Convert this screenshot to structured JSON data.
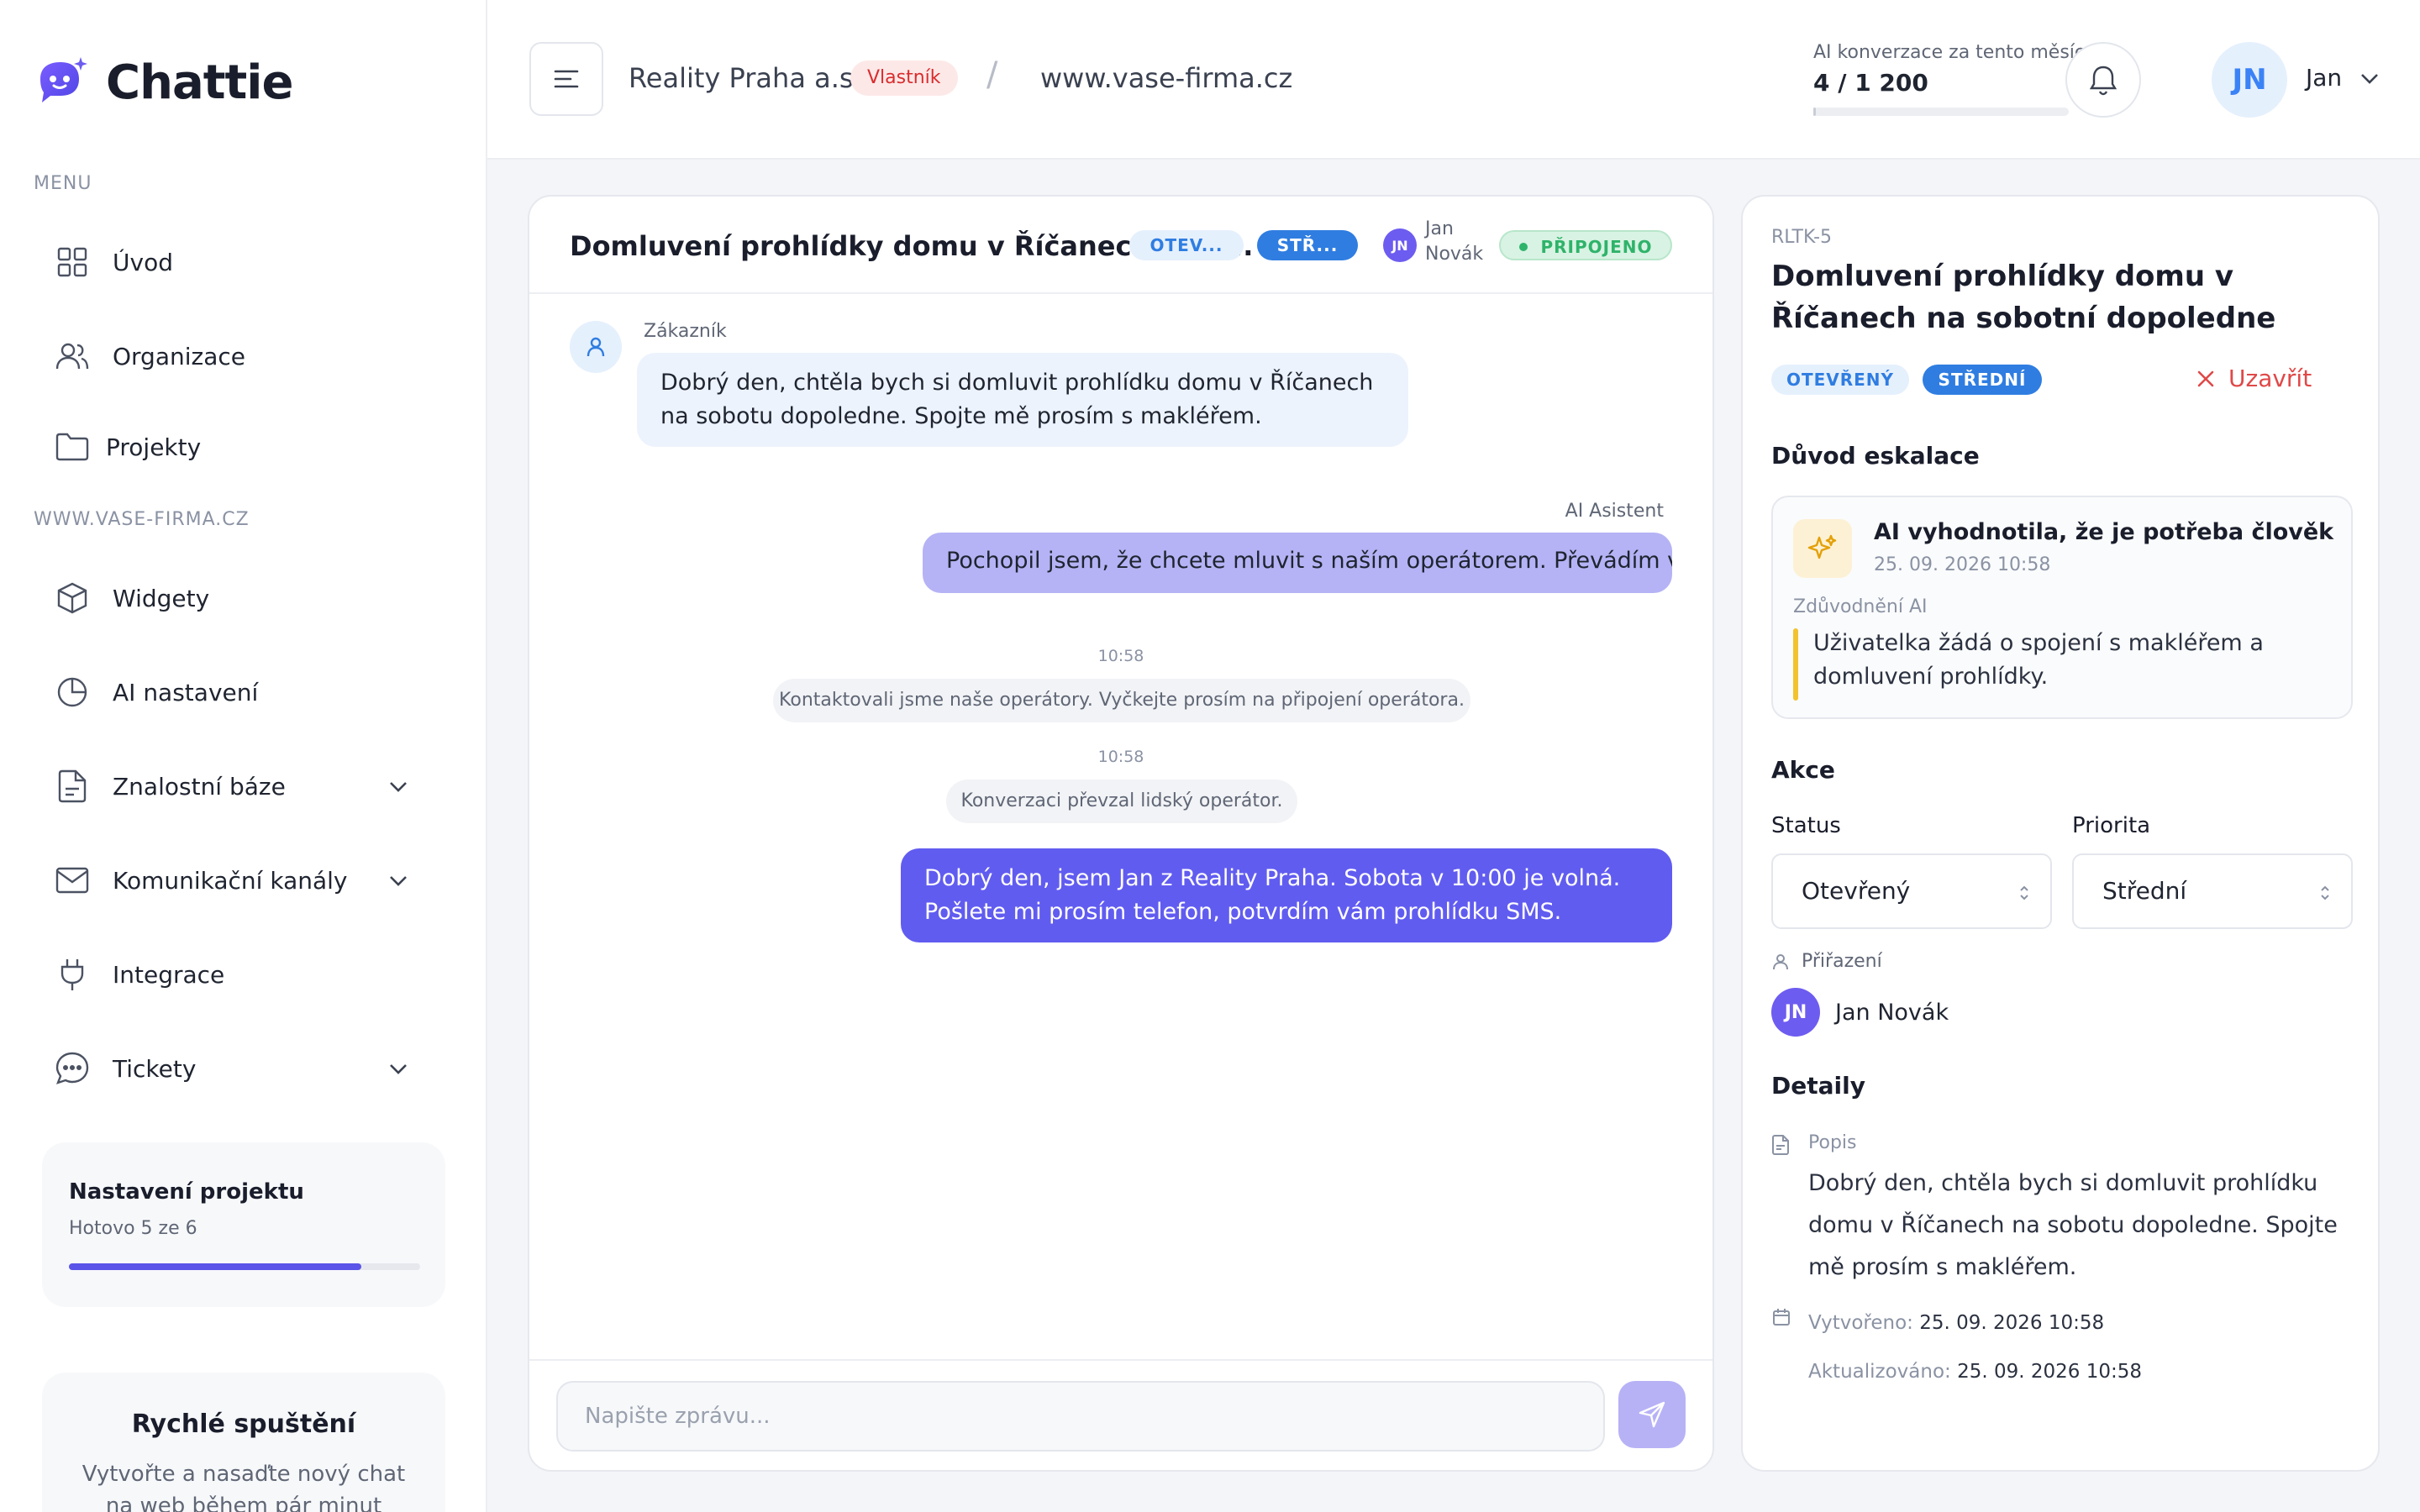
{
  "app": {
    "name": "Chattie",
    "colors": {
      "accent": "#5b54e8",
      "brand": "#5b54e8",
      "danger": "#d92d2d",
      "success": "#2fb36a"
    }
  },
  "sidebar": {
    "menu_label": "MENU",
    "items": [
      {
        "label": "Úvod",
        "icon": "grid-icon"
      },
      {
        "label": "Organizace",
        "icon": "users-icon"
      },
      {
        "label": "Projekty",
        "icon": "folder-icon"
      }
    ],
    "project_label": "WWW.VASE-FIRMA.CZ",
    "project_items": [
      {
        "label": "Widgety",
        "icon": "cube-icon"
      },
      {
        "label": "AI nastavení",
        "icon": "pie-icon"
      },
      {
        "label": "Znalostní báze",
        "icon": "document-icon",
        "expandable": true
      },
      {
        "label": "Komunikační kanály",
        "icon": "mail-icon",
        "expandable": true
      },
      {
        "label": "Integrace",
        "icon": "plug-icon"
      },
      {
        "label": "Tickety",
        "icon": "chat-icon",
        "expandable": true
      }
    ],
    "setup_card": {
      "title": "Nastavení projektu",
      "subtitle": "Hotovo 5 ze 6",
      "progress": 0.833
    },
    "quick_card": {
      "title": "Rychlé spuštění",
      "text": "Vytvořte a nasaďte nový chat na web během pár minut"
    }
  },
  "topbar": {
    "org_name": "Reality Praha a.s.",
    "role": "Vlastník",
    "separator": "/",
    "site": "www.vase-firma.cz",
    "usage_label": "AI konverzace za tento měsíc",
    "usage_count": "4 / 1 200",
    "usage_fraction": 0.0033,
    "user_initials": "JN",
    "user_name": "Jan"
  },
  "chat": {
    "title": "Domluvení prohlídky domu v Říčanech na s...",
    "status_pill": "OTEV...",
    "priority_pill": "STŘ...",
    "assignee_initials": "JN",
    "assignee_first": "Jan",
    "assignee_last": "Novák",
    "connection": "PŘIPOJENO",
    "messages": {
      "customer_author": "Zákazník",
      "customer_text": "Dobrý den, chtěla bych si domluvit prohlídku domu v Říčanech na sobotu dopoledne. Spojte mě prosím s makléřem.",
      "ai_author": "AI Asistent",
      "ai_text": "Pochopil jsem, že chcete mluvit s naším operátorem. Převádím vás...",
      "sys1_time": "10:58",
      "sys1_text": "Kontaktovali jsme naše operátory. Vyčkejte prosím na připojení operátora.",
      "sys2_time": "10:58",
      "sys2_text": "Konverzaci převzal lidský operátor.",
      "agent_text": "Dobrý den, jsem Jan z Reality Praha. Sobota v 10:00 je volná. Pošlete mi prosím telefon, potvrdím vám prohlídku SMS."
    },
    "composer_placeholder": "Napište zprávu..."
  },
  "detail": {
    "ticket_id": "RLTK-5",
    "title": "Domluvení prohlídky domu v Říčanech na sobotní dopoledne",
    "status_badge": "OTEVŘENÝ",
    "priority_badge": "STŘEDNÍ",
    "close_label": "Uzavřít",
    "escalation_heading": "Důvod eskalace",
    "escalation_title": "AI vyhodnotila, že je potřeba člověk",
    "escalation_time": "25. 09. 2026 10:58",
    "reason_label": "Zdůvodnění AI",
    "reason_text": "Uživatelka žádá o spojení s makléřem a domluvení prohlídky.",
    "actions_heading": "Akce",
    "status_label": "Status",
    "status_value": "Otevřený",
    "priority_label": "Priorita",
    "priority_value": "Střední",
    "assigned_label": "Přiřazení",
    "assigned_initials": "JN",
    "assigned_name": "Jan Novák",
    "details_heading": "Detaily",
    "description_label": "Popis",
    "description": "Dobrý den, chtěla bych si domluvit prohlídku domu v Říčanech na sobotu dopoledne. Spojte mě prosím s makléřem.",
    "created_label": "Vytvořeno:",
    "created_value": "25. 09. 2026 10:58",
    "updated_label": "Aktualizováno:",
    "updated_value": "25. 09. 2026 10:58"
  }
}
